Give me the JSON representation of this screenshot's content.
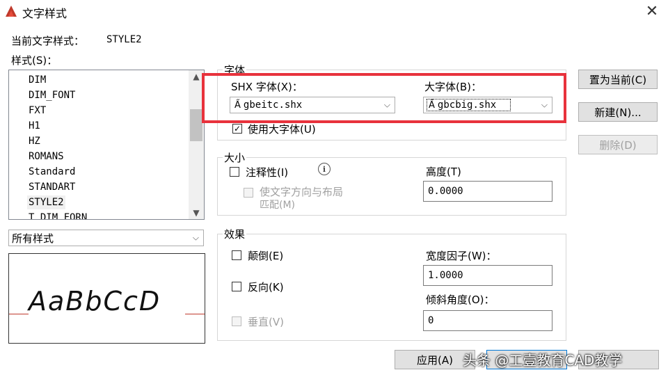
{
  "window": {
    "title": "文字样式",
    "close_label": "✕"
  },
  "current_style": {
    "label": "当前文字样式：",
    "value": "STYLE2"
  },
  "styles": {
    "label": "样式(S)：",
    "items": [
      "DIM",
      "DIM_FONT",
      "FXT",
      "H1",
      "HZ",
      "ROMANS",
      "Standard",
      "STANDART",
      "STYLE2",
      "T_DIM_FORN"
    ],
    "selected": "STYLE2"
  },
  "filter": {
    "value": "所有样式"
  },
  "preview": {
    "sample": "AaBbCcD"
  },
  "font": {
    "group_label": "字体",
    "shx_label": "SHX 字体(X)：",
    "shx_value": "gbeitc.shx",
    "big_label": "大字体(B)：",
    "big_value": "gbcbig.shx",
    "use_bigfont_label": "使用大字体(U)",
    "use_bigfont_checked": true
  },
  "size": {
    "group_label": "大小",
    "annotative_label": "注释性(I)",
    "match_layout_line1": "使文字方向与布局",
    "match_layout_line2": "匹配(M)",
    "height_label": "高度(T)",
    "height_value": "0.0000"
  },
  "effects": {
    "group_label": "效果",
    "upside_down_label": "颠倒(E)",
    "backwards_label": "反向(K)",
    "vertical_label": "垂直(V)",
    "width_label": "宽度因子(W)：",
    "width_value": "1.0000",
    "oblique_label": "倾斜角度(O)：",
    "oblique_value": "0"
  },
  "buttons": {
    "set_current": "置为当前(C)",
    "new": "新建(N)...",
    "delete": "删除(D)",
    "apply": "应用(A)"
  },
  "watermark": "头条 @工壹教育CAD教学",
  "colors": {
    "highlight_frame": "#e8323c"
  }
}
